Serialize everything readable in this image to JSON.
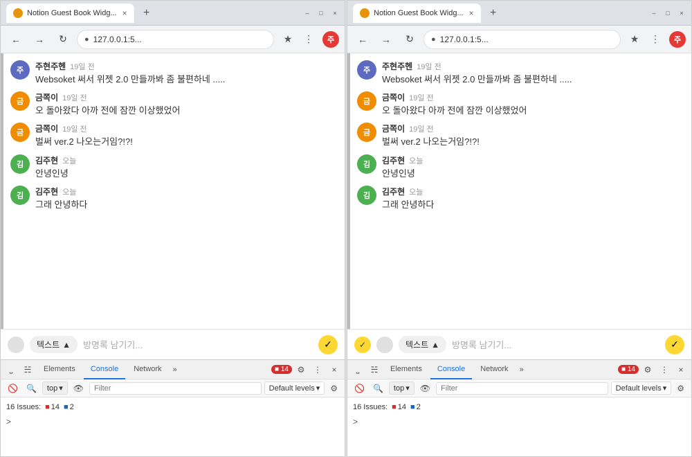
{
  "windows": [
    {
      "id": "left",
      "title": "Notion Guest Book Widg...",
      "favicon": "N",
      "url": "127.0.0.1:5...",
      "tab_close": "×",
      "new_tab": "+",
      "win_controls": [
        "–",
        "□",
        "×"
      ],
      "messages": [
        {
          "author": "주현주헨",
          "avatar_label": "주",
          "avatar_class": "avatar-jh",
          "time": "19일 전",
          "text": "Websoket 써서 위젯 2.0 만들까봐 좀 불편하네 ....."
        },
        {
          "author": "금쪽이",
          "avatar_label": "금",
          "avatar_class": "avatar-gj",
          "time": "19일 전",
          "text": "오 돌아왔다 아까 전에 잠깐 이상했었어"
        },
        {
          "author": "금쪽이",
          "avatar_label": "금",
          "avatar_class": "avatar-gj",
          "time": "19일 전",
          "text": "벌써 ver.2 나오는거임?!?!"
        },
        {
          "author": "김주현",
          "avatar_label": "김",
          "avatar_class": "avatar-kjh",
          "time": "오늘",
          "text": "안녕인녕"
        },
        {
          "author": "김주현",
          "avatar_label": "김",
          "avatar_class": "avatar-kjh",
          "time": "오늘",
          "text": "그래 안녕하다"
        }
      ],
      "input": {
        "type_label": "텍스트",
        "placeholder": "방명록 남기기...",
        "send_icon": "✓"
      },
      "devtools": {
        "tabs": [
          "Elements",
          "Console",
          "Network"
        ],
        "active_tab": "Console",
        "more": "»",
        "badge_count": "14",
        "badge_warn": "2",
        "settings_icon": "⚙",
        "close_icon": "×",
        "toolbar": {
          "clear_icon": "🚫",
          "filter_placeholder": "Filter",
          "top_label": "top",
          "dropdown_icon": "▾",
          "eye_icon": "👁",
          "levels_label": "Default levels",
          "levels_icon": "▾",
          "settings_icon": "⚙"
        },
        "issues_label": "16 Issues:",
        "error_count": "14",
        "warn_count": "2",
        "prompt": ">"
      }
    },
    {
      "id": "right",
      "title": "Notion Guest Book Widg...",
      "favicon": "N",
      "url": "127.0.0.1:5...",
      "tab_close": "×",
      "new_tab": "+",
      "win_controls": [
        "–",
        "□",
        "×"
      ],
      "messages": [
        {
          "author": "주현주헨",
          "avatar_label": "주",
          "avatar_class": "avatar-jh",
          "time": "19일 전",
          "text": "Websoket 써서 위젯 2.0 만들까봐 좀 불편하네 ....."
        },
        {
          "author": "금쪽이",
          "avatar_label": "금",
          "avatar_class": "avatar-gj",
          "time": "19일 전",
          "text": "오 돌아왔다 아까 전에 잠깐 이상했었어"
        },
        {
          "author": "금쪽이",
          "avatar_label": "금",
          "avatar_class": "avatar-gj",
          "time": "19일 전",
          "text": "벌써 ver.2 나오는거임?!?!"
        },
        {
          "author": "김주현",
          "avatar_label": "김",
          "avatar_class": "avatar-kjh",
          "time": "오늘",
          "text": "안녕인녕"
        },
        {
          "author": "김주현",
          "avatar_label": "김",
          "avatar_class": "avatar-kjh",
          "time": "오늘",
          "text": "그래 안녕하다"
        }
      ],
      "input": {
        "type_label": "텍스트",
        "placeholder": "방명록 남기기...",
        "send_icon": "✓"
      },
      "devtools": {
        "tabs": [
          "Elements",
          "Console",
          "Network"
        ],
        "active_tab": "Console",
        "more": "»",
        "badge_count": "14",
        "badge_warn": "2",
        "settings_icon": "⚙",
        "close_icon": "×",
        "toolbar": {
          "clear_icon": "🚫",
          "filter_placeholder": "Filter",
          "top_label": "top",
          "dropdown_icon": "▾",
          "eye_icon": "👁",
          "levels_label": "Default levels",
          "levels_icon": "▾",
          "settings_icon": "⚙"
        },
        "issues_label": "16 Issues:",
        "error_count": "14",
        "warn_count": "2",
        "prompt": ">"
      }
    }
  ]
}
